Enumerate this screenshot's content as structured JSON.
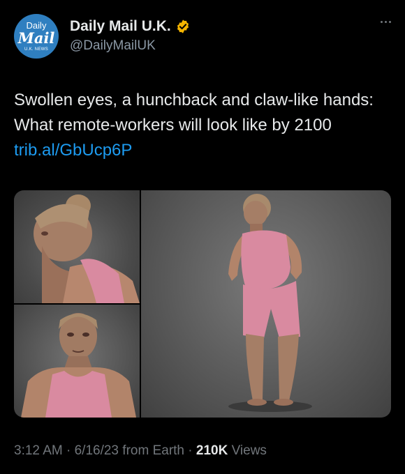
{
  "account": {
    "avatar_line1": "Daily",
    "avatar_line2": "Mail",
    "avatar_line3": "U.K. NEWS",
    "display_name": "Daily Mail U.K.",
    "handle": "@DailyMailUK",
    "verified_badge_color": "#f4b400"
  },
  "tweet": {
    "text": "Swollen eyes, a hunchback and claw-like hands: What remote-workers will look like by 2100",
    "link": "trib.al/GbUcp6P"
  },
  "media": {
    "images": [
      "side-profile-portrait",
      "front-portrait",
      "full-body-figure"
    ]
  },
  "meta": {
    "time": "3:12 AM",
    "separator": " · ",
    "date": "6/16/23",
    "source": "from Earth",
    "views_count": "210K",
    "views_label": "Views"
  },
  "colors": {
    "background": "#000000",
    "text": "#e7e9ea",
    "muted": "#71767b",
    "link": "#1d9bf0",
    "avatar": "#2f7fc0"
  }
}
